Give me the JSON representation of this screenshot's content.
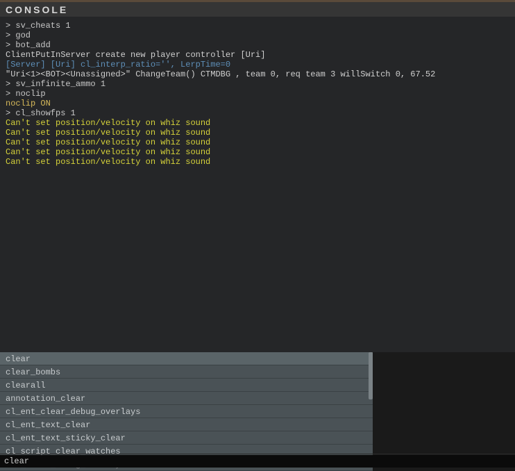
{
  "title": "CONSOLE",
  "log": [
    {
      "text": "> sv_cheats 1",
      "class": "prompt-line"
    },
    {
      "text": "> god",
      "class": "prompt-line"
    },
    {
      "text": "> bot_add",
      "class": "prompt-line"
    },
    {
      "text": "ClientPutInServer create new player controller [Uri]",
      "class": "info-line"
    },
    {
      "text": "[Server] [Uri] cl_interp_ratio='', LerpTime=0",
      "class": "server-line"
    },
    {
      "text": "\"Uri<1><BOT><Unassigned>\" ChangeTeam() CTMDBG , team 0, req team 3 willSwitch 0, 67.52",
      "class": "info-line"
    },
    {
      "text": "> sv_infinite_ammo 1",
      "class": "prompt-line"
    },
    {
      "text": "> noclip",
      "class": "prompt-line"
    },
    {
      "text": "noclip ON",
      "class": "noclip-line"
    },
    {
      "text": "> cl_showfps 1",
      "class": "prompt-line"
    },
    {
      "text": "Can't set position/velocity on whiz sound",
      "class": "warn-line"
    },
    {
      "text": "Can't set position/velocity on whiz sound",
      "class": "warn-line"
    },
    {
      "text": "Can't set position/velocity on whiz sound",
      "class": "warn-line"
    },
    {
      "text": "Can't set position/velocity on whiz sound",
      "class": "warn-line"
    },
    {
      "text": "Can't set position/velocity on whiz sound",
      "class": "warn-line"
    }
  ],
  "autocomplete": [
    {
      "label": "clear",
      "highlight": true
    },
    {
      "label": "clear_bombs",
      "highlight": false
    },
    {
      "label": "clearall",
      "highlight": false
    },
    {
      "label": "annotation_clear",
      "highlight": false
    },
    {
      "label": "cl_ent_clear_debug_overlays",
      "highlight": false
    },
    {
      "label": "cl_ent_text_clear",
      "highlight": false
    },
    {
      "label": "cl_ent_text_sticky_clear",
      "highlight": false
    },
    {
      "label": "cl_script_clear_watches",
      "highlight": false
    },
    {
      "label": "ent_clear_debug_overlays",
      "highlight": false,
      "faded": true
    }
  ],
  "input_value": "clear"
}
